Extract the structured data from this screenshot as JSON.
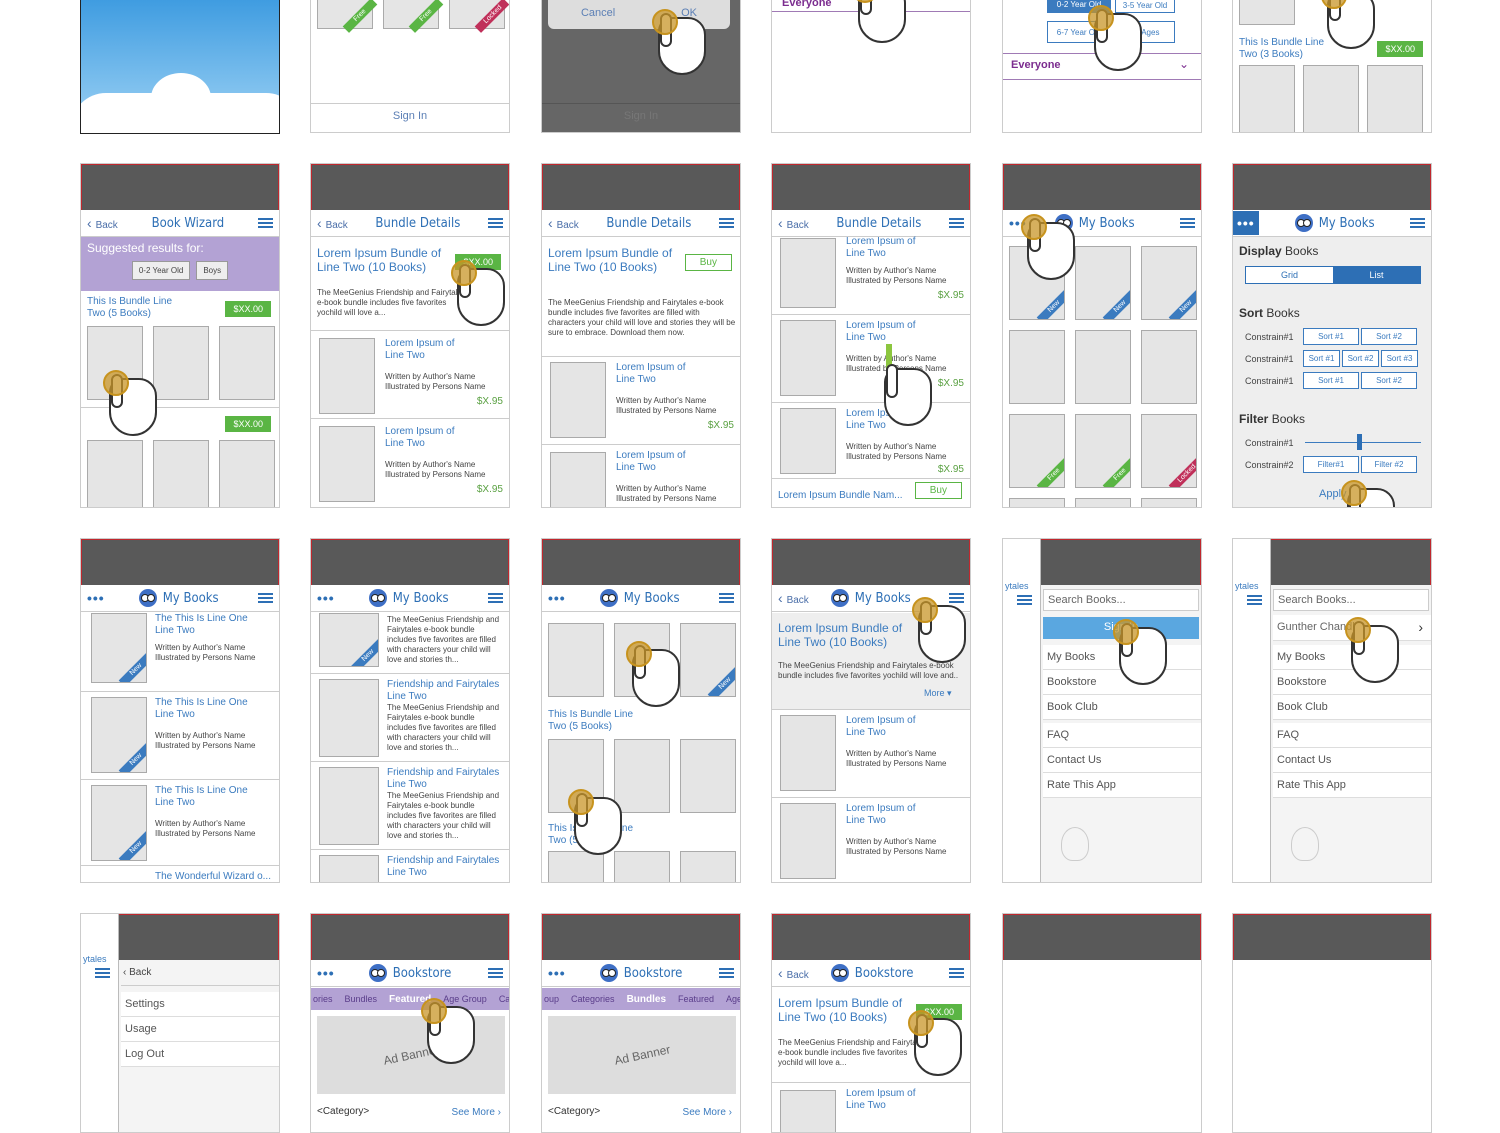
{
  "row1": {
    "tile2_ribbons": [
      "Free",
      "Free",
      "Locked"
    ],
    "sign_in": "Sign In",
    "cancel": "Cancel",
    "ok": "OK",
    "everyone": "Everyone",
    "age_chips": [
      "0-2 Year Old",
      "3-5 Year Old",
      "6-7 Year Old",
      "All Ages"
    ],
    "bundle_title": "This Is Bundle Line Two (3 Books)",
    "price": "$XX.00"
  },
  "common": {
    "back": "Back",
    "book_wizard": "Book Wizard",
    "bundle_details": "Bundle Details",
    "my_books": "My Books",
    "bookstore": "Bookstore",
    "price": "$XX.00",
    "buy": "Buy",
    "book_price": "$X.95",
    "written_by": "Written by Author's Name",
    "illustrated_by": "Illustrated by Persons Name",
    "lorem_item": "Lorem Ipsum of Line Two",
    "bundle_name": "Lorem Ipsum Bundle of Line Two (10 Books)",
    "bundle_desc_short": "The MeeGenius Friendship and Fairytales e-book bundle includes five favorites yochild will love a...",
    "bundle_desc_long": "The MeeGenius Friendship and Fairytales e-book bundle includes five favorites are filled with characters your child will love and stories they will be sure to embrace. Download them now.",
    "new": "New",
    "free": "Free",
    "locked": "Locked"
  },
  "wizard": {
    "suggested": "Suggested results for:",
    "chips": [
      "0-2 Year Old",
      "Boys"
    ],
    "bundle1": "This Is Bundle Line Two (5 Books)"
  },
  "detail4": {
    "bottom_bar": "Lorem Ipsum Bundle Nam..."
  },
  "filter": {
    "display": "Display",
    "books": "Books",
    "grid": "Grid",
    "list": "List",
    "sort": "Sort",
    "filter": "Filter",
    "constraints": [
      "Constrain#1",
      "Constrain#1",
      "Constrain#1"
    ],
    "sort_rows": [
      [
        "Sort #1",
        "Sort #2"
      ],
      [
        "Sort #1",
        "Sort #2",
        "Sort #3"
      ],
      [
        "Sort #1",
        "Sort #2"
      ]
    ],
    "filter_c1": "Constrain#1",
    "filter_c2": "Constrain#2",
    "filter_btns": [
      "Filter#1",
      "Filter #2"
    ],
    "apply": "Apply"
  },
  "list": {
    "titles": [
      "The This Is Line One Line Two",
      "The This Is Line One Line Two",
      "The This Is Line One Line Two"
    ],
    "wonderful": "The Wonderful Wizard o...",
    "friendship": "Friendship and Fairytales Line Two",
    "desc": "The MeeGenius Friendship and Fairytales e-book bundle includes five favorites are filled with characters your child will love and stories th..."
  },
  "grid3": {
    "bundle": "This Is Bundle Line Two (5 Books)"
  },
  "detail_more": {
    "desc": "The MeeGenius Friendship and Fairytales e-book bundle includes five favorites yochild will love and..",
    "more": "More"
  },
  "menu": {
    "search": "Search Books...",
    "sign_in": "Sign In",
    "user": "Gunther Chandle",
    "items": [
      "My Books",
      "Bookstore",
      "Book Club"
    ],
    "items2": [
      "FAQ",
      "Contact Us",
      "Rate This App"
    ],
    "settings": [
      "Settings",
      "Usage",
      "Log Out"
    ],
    "back": "Back"
  },
  "store": {
    "tabs1": [
      "ories",
      "Bundles",
      "Featured",
      "Age Group",
      "Ca"
    ],
    "tabs2": [
      "oup",
      "Categories",
      "Bundles",
      "Featured",
      "Age"
    ],
    "ad": "Ad Banner",
    "category": "<Category>",
    "see_more": "See More"
  }
}
